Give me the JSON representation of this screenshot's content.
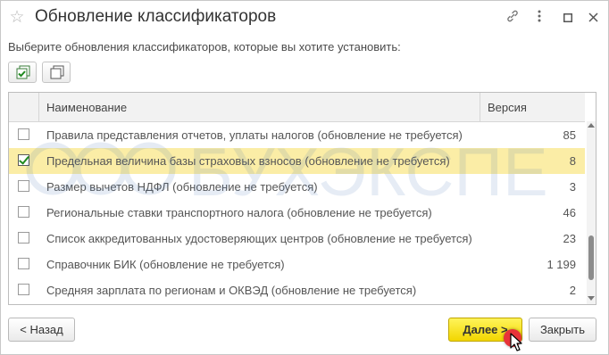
{
  "window": {
    "title": "Обновление классификаторов"
  },
  "prompt": "Выберите обновления классификаторов, которые вы хотите установить:",
  "grid": {
    "columns": {
      "name": "Наименование",
      "version": "Версия"
    },
    "rows": [
      {
        "checked": false,
        "name": "Правила представления отчетов, уплаты налогов (обновление не требуется)",
        "version": "85"
      },
      {
        "checked": true,
        "name": "Предельная величина базы страховых взносов (обновление не требуется)",
        "version": "8"
      },
      {
        "checked": false,
        "name": "Размер вычетов НДФЛ (обновление не требуется)",
        "version": "3"
      },
      {
        "checked": false,
        "name": "Региональные ставки транспортного налога (обновление не требуется)",
        "version": "46"
      },
      {
        "checked": false,
        "name": "Список аккредитованных удостоверяющих центров (обновление не требуется)",
        "version": "23"
      },
      {
        "checked": false,
        "name": "Справочник БИК (обновление не требуется)",
        "version": "1 199"
      },
      {
        "checked": false,
        "name": "Средняя зарплата по регионам и ОКВЭД (обновление не требуется)",
        "version": "2"
      }
    ],
    "selected_row": 1
  },
  "watermark": "БУХЭКСПЕ",
  "buttons": {
    "back": "< Назад",
    "next": "Далее >",
    "close": "Закрыть"
  },
  "colors": {
    "selected_row": "#fbeda6",
    "primary_button": "#f2d600",
    "check_mark": "#1f8a1f"
  }
}
